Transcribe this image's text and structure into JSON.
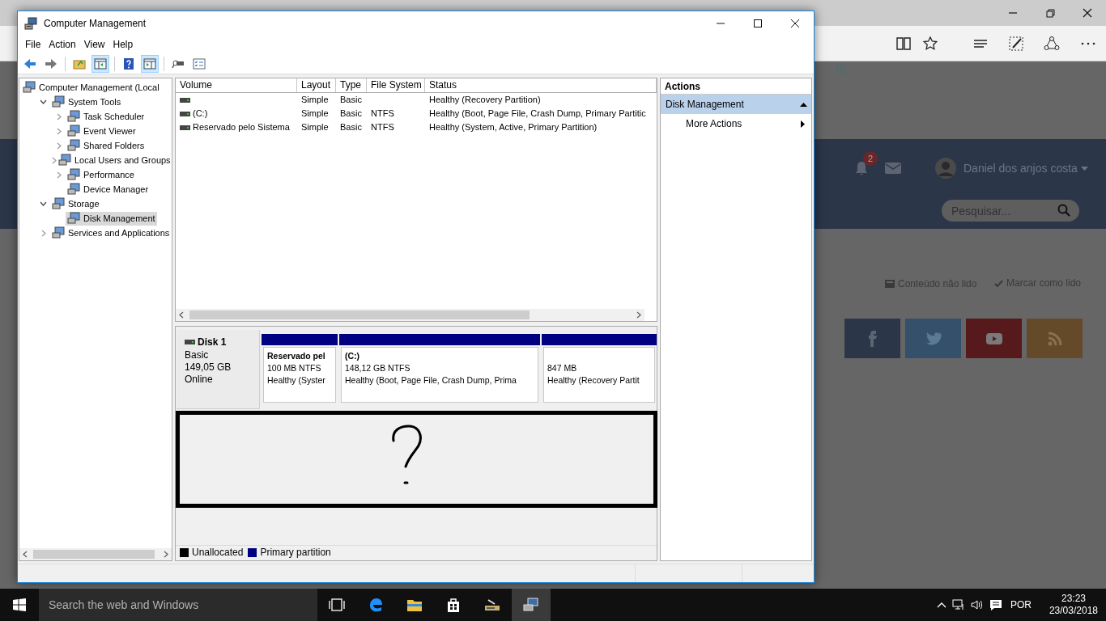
{
  "browser": {
    "notification_count": "2",
    "user_name": "Daniel dos anjos costa",
    "search": {
      "placeholder": "Pesquisar..."
    },
    "links": [
      "Conteúdo não lido",
      "Marcar como lido"
    ]
  },
  "window": {
    "title": "Computer Management",
    "menu": [
      "File",
      "Action",
      "View",
      "Help"
    ],
    "tree": [
      {
        "label": "Computer Management (Local",
        "selected": false,
        "children": [
          {
            "label": "System Tools",
            "selected": false,
            "expanded": true,
            "children": [
              {
                "label": "Task Scheduler",
                "selected": false,
                "expanded": false
              },
              {
                "label": "Event Viewer",
                "selected": false,
                "expanded": false
              },
              {
                "label": "Shared Folders",
                "selected": false,
                "expanded": false
              },
              {
                "label": "Local Users and Groups",
                "selected": false,
                "expanded": false
              },
              {
                "label": "Performance",
                "selected": false,
                "expanded": false
              },
              {
                "label": "Device Manager",
                "selected": false
              }
            ]
          },
          {
            "label": "Storage",
            "selected": false,
            "expanded": true,
            "children": [
              {
                "label": "Disk Management",
                "selected": true
              }
            ]
          },
          {
            "label": "Services and Applications",
            "selected": false,
            "expanded": false
          }
        ]
      }
    ],
    "volumes": {
      "columns": [
        "Volume",
        "Layout",
        "Type",
        "File System",
        "Status"
      ],
      "rows": [
        [
          "",
          "Simple",
          "Basic",
          "",
          "Healthy (Recovery Partition)"
        ],
        [
          "(C:)",
          "Simple",
          "Basic",
          "NTFS",
          "Healthy (Boot, Page File, Crash Dump, Primary Partitic"
        ],
        [
          "Reservado pelo Sistema",
          "Simple",
          "Basic",
          "NTFS",
          "Healthy (System, Active, Primary Partition)"
        ]
      ]
    },
    "disk": {
      "name": "Disk 1",
      "type": "Basic",
      "size": "149,05 GB",
      "status": "Online",
      "partitions": [
        {
          "name": "Reservado pel",
          "size": "100 MB NTFS",
          "status": "Healthy (Syster"
        },
        {
          "name": "(C:)",
          "size": "148,12 GB NTFS",
          "status": "Healthy (Boot, Page File, Crash Dump, Prima"
        },
        {
          "size": "847 MB",
          "status": "Healthy (Recovery Partit"
        }
      ]
    },
    "legend": [
      {
        "label": "Unallocated",
        "color": "#000000"
      },
      {
        "label": "Primary partition",
        "color": "#000080"
      }
    ],
    "actions": {
      "title": "Actions",
      "section": {
        "label": "Disk Management",
        "expanded": true
      },
      "items": [
        "More Actions"
      ]
    }
  },
  "taskbar": {
    "search": {
      "placeholder": "Search the web and Windows"
    },
    "apps": [
      {
        "active": false
      },
      {
        "active": false
      },
      {
        "active": false
      },
      {
        "active": false
      },
      {
        "active": false
      },
      {
        "active": true
      }
    ],
    "language": "POR",
    "time": "23:23",
    "date": "23/03/2018"
  }
}
